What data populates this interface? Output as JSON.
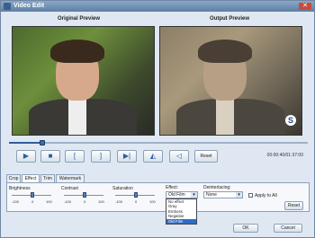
{
  "window": {
    "title": "Video Edit",
    "close_label": "✕"
  },
  "preview": {
    "original_label": "Original Preview",
    "output_label": "Output Preview",
    "output_logo": "S"
  },
  "playback": {
    "progress_fraction": 0.11,
    "time": "00:00:40/01:37:00",
    "reset_label": "Reset",
    "buttons": [
      {
        "name": "play-icon",
        "glyph": "▶"
      },
      {
        "name": "stop-icon",
        "glyph": "■"
      },
      {
        "name": "mark-in-icon",
        "glyph": "["
      },
      {
        "name": "mark-out-icon",
        "glyph": "]"
      },
      {
        "name": "next-frame-icon",
        "glyph": "▶|"
      },
      {
        "name": "flip-horizontal-icon",
        "glyph": "◭"
      },
      {
        "name": "rotate-icon",
        "glyph": "◁"
      }
    ]
  },
  "tabs": [
    "Crop",
    "Effect",
    "Trim",
    "Watermark"
  ],
  "active_tab": "Effect",
  "effect_panel": {
    "brightness": {
      "label": "Brightness",
      "min": "-100",
      "zero": "0",
      "max": "100",
      "value": 0
    },
    "contrast": {
      "label": "Contrast",
      "min": "-100",
      "zero": "0",
      "max": "100",
      "value": 0
    },
    "saturation": {
      "label": "Saturation",
      "min": "-100",
      "zero": "0",
      "max": "100",
      "value": 0
    },
    "effect": {
      "label": "Effect:",
      "selected": "Old Film",
      "options": [
        "No effect",
        "Gray",
        "Emboss",
        "Negative",
        "Old Film"
      ]
    },
    "deinterlacing": {
      "label": "Deinterlacing:",
      "selected": "None"
    },
    "apply_to_all": {
      "label": "Apply to All",
      "checked": false
    },
    "reset_label": "Reset"
  },
  "footer": {
    "ok_label": "OK",
    "cancel_label": "Cancel"
  },
  "colors": {
    "accent": "#2f5e9a",
    "selected_option": "#2f6dc4"
  }
}
